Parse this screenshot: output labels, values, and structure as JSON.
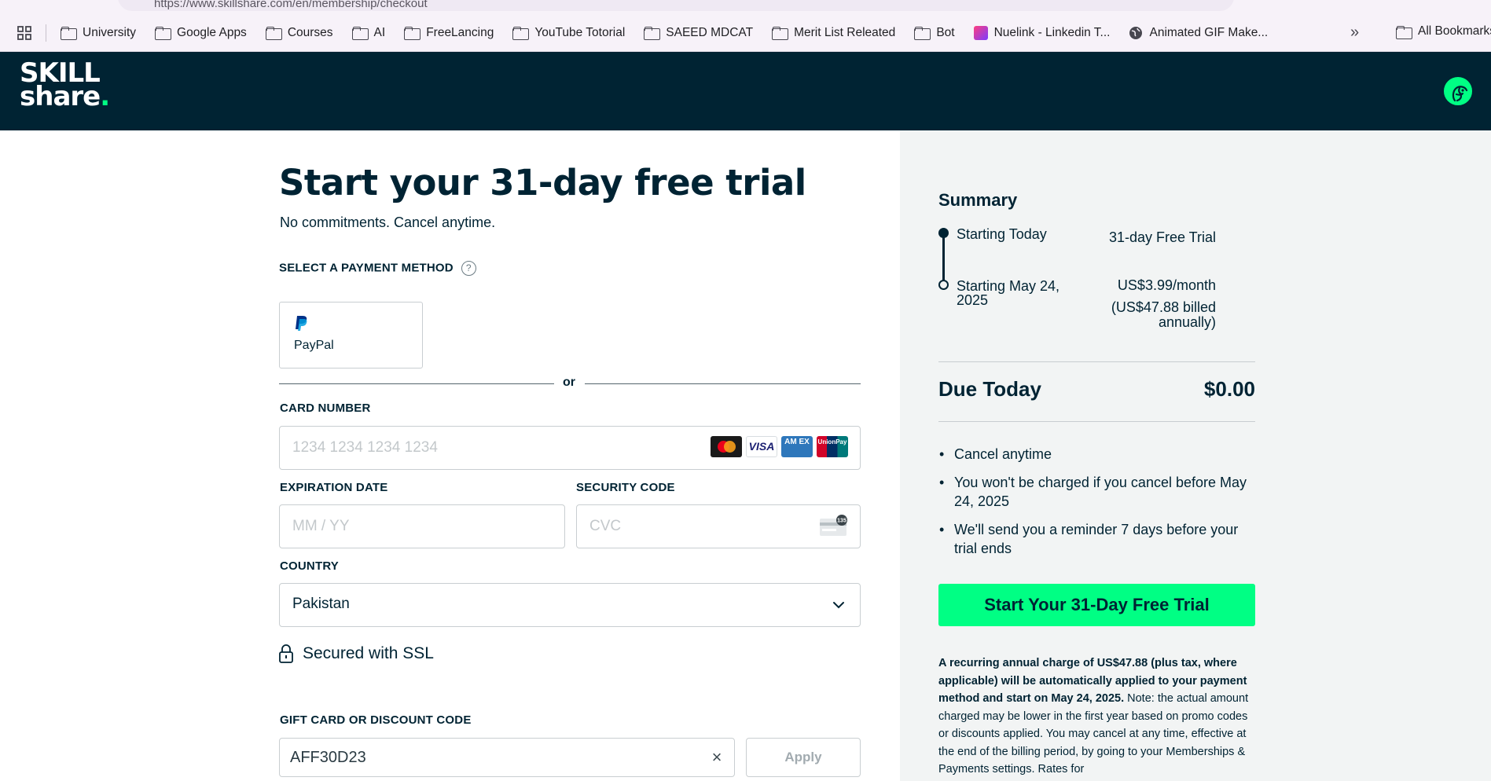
{
  "browser": {
    "url": "https://www.skillshare.com/en/membership/checkout",
    "bookmarks": [
      {
        "label": "University",
        "icon": "folder-icon"
      },
      {
        "label": "Google Apps",
        "icon": "folder-icon"
      },
      {
        "label": "Courses",
        "icon": "folder-icon"
      },
      {
        "label": "AI",
        "icon": "folder-icon"
      },
      {
        "label": "FreeLancing",
        "icon": "folder-icon"
      },
      {
        "label": "YouTube Totorial",
        "icon": "folder-icon"
      },
      {
        "label": "SAEED MDCAT",
        "icon": "folder-icon"
      },
      {
        "label": "Merit List Releated",
        "icon": "folder-icon"
      },
      {
        "label": "Bot",
        "icon": "folder-icon"
      },
      {
        "label": "Nuelink - Linkedin T...",
        "icon": "nuelink-icon"
      },
      {
        "label": "Animated GIF Make...",
        "icon": "globe-icon"
      }
    ],
    "overflow_label": "»",
    "all_bookmarks": "All Bookmarks"
  },
  "header": {
    "logo_line1": "SKILL",
    "logo_line2": "share",
    "logo_dot": "."
  },
  "form": {
    "title": "Start your 31-day free trial",
    "subtitle": "No commitments. Cancel anytime.",
    "payment_method_label": "SELECT A PAYMENT METHOD",
    "help_symbol": "?",
    "paypal_label": "PayPal",
    "or_label": "or",
    "card_number_label": "CARD NUMBER",
    "card_number_placeholder": "1234 1234 1234 1234",
    "expiration_label": "EXPIRATION DATE",
    "expiration_placeholder": "MM / YY",
    "security_label": "SECURITY CODE",
    "security_placeholder": "CVC",
    "country_label": "COUNTRY",
    "country_value": "Pakistan",
    "ssl_label": "Secured with SSL",
    "gift_label": "GIFT CARD OR DISCOUNT CODE",
    "gift_value": "AFF30D23",
    "apply_label": "Apply",
    "card_brands": {
      "visa": "VISA",
      "amex": "AM EX",
      "unionpay": "UnionPay"
    },
    "cvc_badge": "135"
  },
  "summary": {
    "title": "Summary",
    "row1_left": "Starting Today",
    "row1_right": "31-day Free Trial",
    "row2_left_line1": "Starting May 24,",
    "row2_left_line2": "2025",
    "row2_right_line1": "US$3.99/month",
    "row2_right_line2": "(US$47.88 billed",
    "row2_right_line3": "annually)",
    "due_label": "Due Today",
    "due_value": "$0.00",
    "bullets": [
      "Cancel anytime",
      "You won't be charged if you cancel before May 24, 2025",
      "We'll send you a reminder 7 days before your trial ends"
    ],
    "cta_label": "Start Your 31-Day Free Trial",
    "fine_bold": "A recurring annual charge of US$47.88 (plus tax, where applicable) will be automatically applied to your payment method and start on May 24, 2025.",
    "fine_rest": " Note: the actual amount charged may be lower in the first year based on promo codes or discounts applied. You may cancel at any time, effective at the end of the billing period, by going to your Memberships & Payments settings. Rates for"
  },
  "colors": {
    "brand_navy": "#002333",
    "brand_green": "#00ff84",
    "panel_bg": "#f2f4f4"
  }
}
